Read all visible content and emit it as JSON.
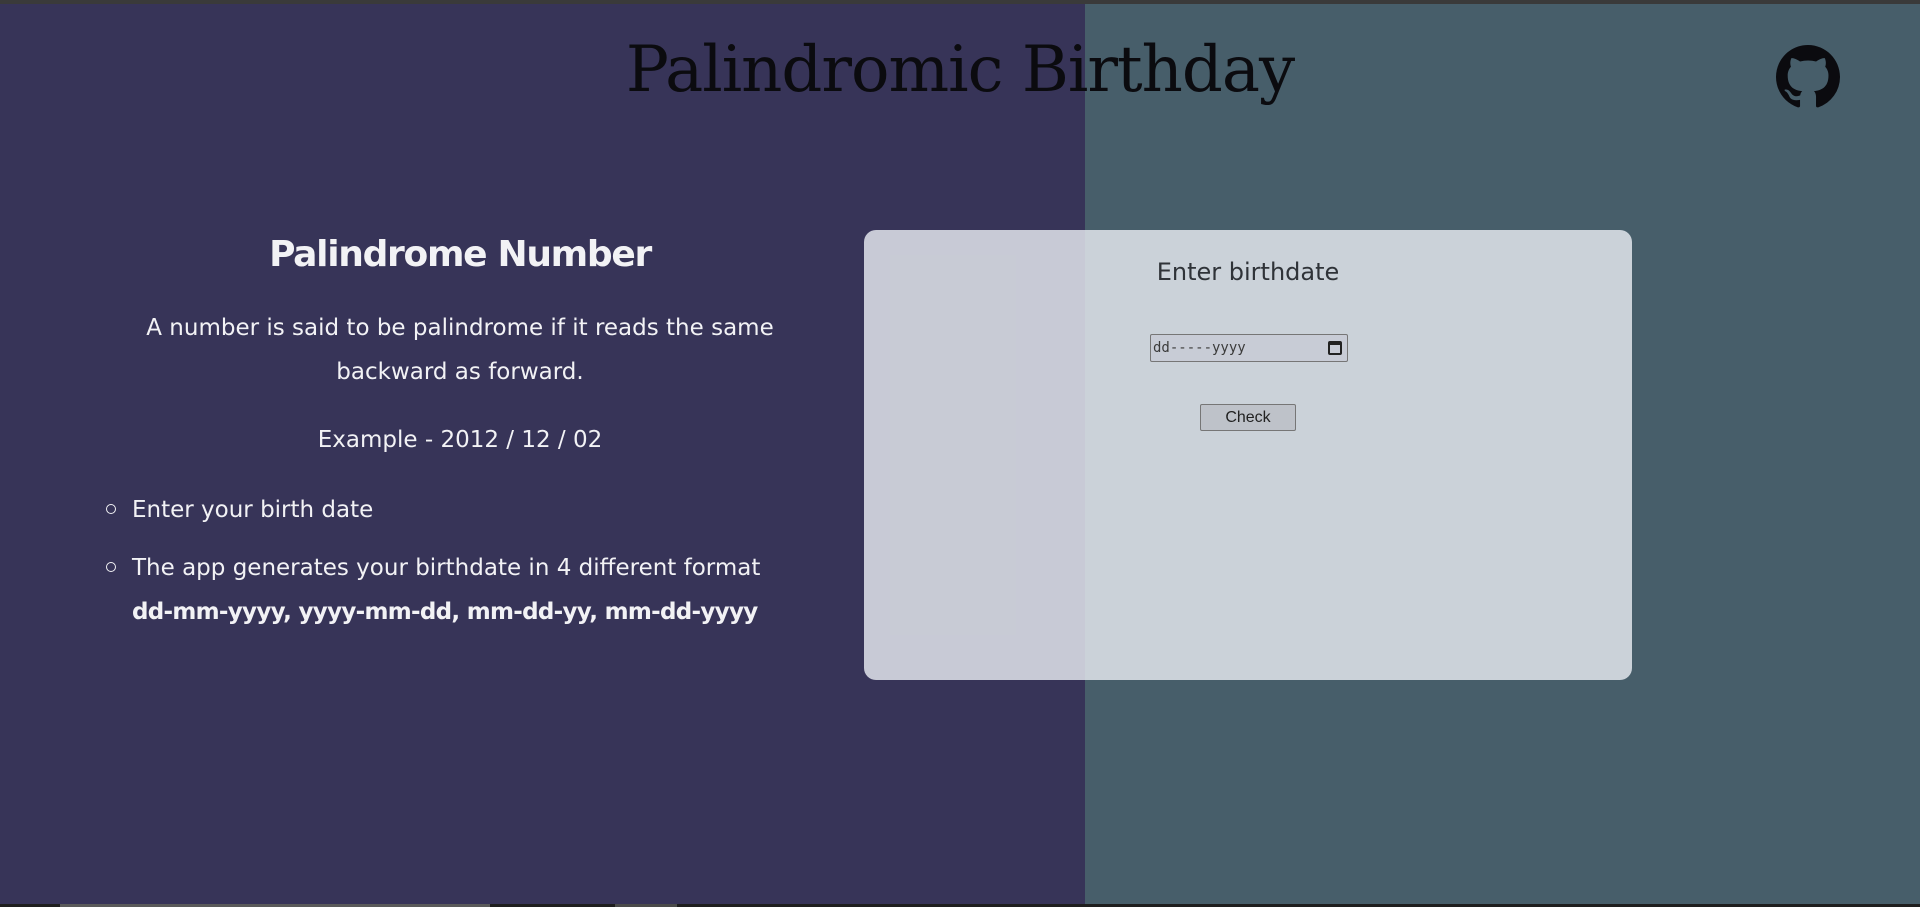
{
  "header": {
    "title": "Palindromic Birthday",
    "github_icon": "github-icon"
  },
  "info": {
    "heading": "Palindrome Number",
    "description": "A number is said to be palindrome if it reads the same backward as forward.",
    "example": "Example - 2012 / 12 / 02",
    "steps": [
      {
        "text": "Enter your birth date"
      },
      {
        "text": "The app generates your birthdate in 4 different format",
        "formats": "dd-mm-yyyy, yyyy-mm-dd, mm-dd-yy, mm-dd-yyyy"
      }
    ]
  },
  "form": {
    "label": "Enter birthdate",
    "date_placeholder": "dd-----yyyy",
    "calendar_icon": "calendar-icon",
    "check_label": "Check"
  },
  "colors": {
    "left_background": "#373458",
    "right_background": "#475e6a",
    "card_background": "#e8ecf1"
  }
}
